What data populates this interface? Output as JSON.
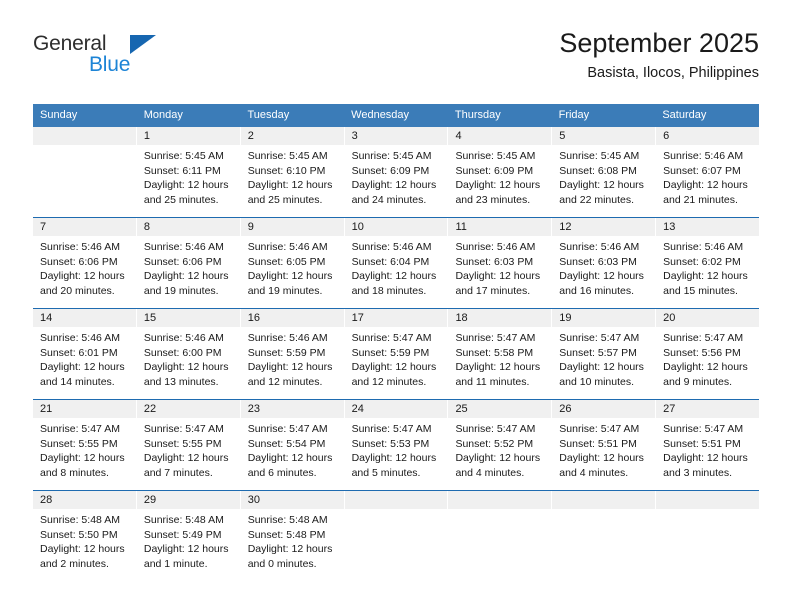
{
  "brand": {
    "name_top": "General",
    "name_bottom": "Blue",
    "accent_dark": "#1666b0",
    "accent_light": "#1d84d6"
  },
  "header": {
    "title": "September 2025",
    "subtitle": "Basista, Ilocos, Philippines"
  },
  "theme": {
    "header_row_bg": "#3b7cb8",
    "week_divider": "#1e6bb0",
    "day_band_bg": "#f0f0f0"
  },
  "weekdays": [
    "Sunday",
    "Monday",
    "Tuesday",
    "Wednesday",
    "Thursday",
    "Friday",
    "Saturday"
  ],
  "weeks": [
    {
      "days": [
        {
          "num": "",
          "sunrise": "",
          "sunset": "",
          "daylight_1": "",
          "daylight_2": "",
          "empty": true
        },
        {
          "num": "1",
          "sunrise": "Sunrise: 5:45 AM",
          "sunset": "Sunset: 6:11 PM",
          "daylight_1": "Daylight: 12 hours",
          "daylight_2": "and 25 minutes."
        },
        {
          "num": "2",
          "sunrise": "Sunrise: 5:45 AM",
          "sunset": "Sunset: 6:10 PM",
          "daylight_1": "Daylight: 12 hours",
          "daylight_2": "and 25 minutes."
        },
        {
          "num": "3",
          "sunrise": "Sunrise: 5:45 AM",
          "sunset": "Sunset: 6:09 PM",
          "daylight_1": "Daylight: 12 hours",
          "daylight_2": "and 24 minutes."
        },
        {
          "num": "4",
          "sunrise": "Sunrise: 5:45 AM",
          "sunset": "Sunset: 6:09 PM",
          "daylight_1": "Daylight: 12 hours",
          "daylight_2": "and 23 minutes."
        },
        {
          "num": "5",
          "sunrise": "Sunrise: 5:45 AM",
          "sunset": "Sunset: 6:08 PM",
          "daylight_1": "Daylight: 12 hours",
          "daylight_2": "and 22 minutes."
        },
        {
          "num": "6",
          "sunrise": "Sunrise: 5:46 AM",
          "sunset": "Sunset: 6:07 PM",
          "daylight_1": "Daylight: 12 hours",
          "daylight_2": "and 21 minutes."
        }
      ]
    },
    {
      "days": [
        {
          "num": "7",
          "sunrise": "Sunrise: 5:46 AM",
          "sunset": "Sunset: 6:06 PM",
          "daylight_1": "Daylight: 12 hours",
          "daylight_2": "and 20 minutes."
        },
        {
          "num": "8",
          "sunrise": "Sunrise: 5:46 AM",
          "sunset": "Sunset: 6:06 PM",
          "daylight_1": "Daylight: 12 hours",
          "daylight_2": "and 19 minutes."
        },
        {
          "num": "9",
          "sunrise": "Sunrise: 5:46 AM",
          "sunset": "Sunset: 6:05 PM",
          "daylight_1": "Daylight: 12 hours",
          "daylight_2": "and 19 minutes."
        },
        {
          "num": "10",
          "sunrise": "Sunrise: 5:46 AM",
          "sunset": "Sunset: 6:04 PM",
          "daylight_1": "Daylight: 12 hours",
          "daylight_2": "and 18 minutes."
        },
        {
          "num": "11",
          "sunrise": "Sunrise: 5:46 AM",
          "sunset": "Sunset: 6:03 PM",
          "daylight_1": "Daylight: 12 hours",
          "daylight_2": "and 17 minutes."
        },
        {
          "num": "12",
          "sunrise": "Sunrise: 5:46 AM",
          "sunset": "Sunset: 6:03 PM",
          "daylight_1": "Daylight: 12 hours",
          "daylight_2": "and 16 minutes."
        },
        {
          "num": "13",
          "sunrise": "Sunrise: 5:46 AM",
          "sunset": "Sunset: 6:02 PM",
          "daylight_1": "Daylight: 12 hours",
          "daylight_2": "and 15 minutes."
        }
      ]
    },
    {
      "days": [
        {
          "num": "14",
          "sunrise": "Sunrise: 5:46 AM",
          "sunset": "Sunset: 6:01 PM",
          "daylight_1": "Daylight: 12 hours",
          "daylight_2": "and 14 minutes."
        },
        {
          "num": "15",
          "sunrise": "Sunrise: 5:46 AM",
          "sunset": "Sunset: 6:00 PM",
          "daylight_1": "Daylight: 12 hours",
          "daylight_2": "and 13 minutes."
        },
        {
          "num": "16",
          "sunrise": "Sunrise: 5:46 AM",
          "sunset": "Sunset: 5:59 PM",
          "daylight_1": "Daylight: 12 hours",
          "daylight_2": "and 12 minutes."
        },
        {
          "num": "17",
          "sunrise": "Sunrise: 5:47 AM",
          "sunset": "Sunset: 5:59 PM",
          "daylight_1": "Daylight: 12 hours",
          "daylight_2": "and 12 minutes."
        },
        {
          "num": "18",
          "sunrise": "Sunrise: 5:47 AM",
          "sunset": "Sunset: 5:58 PM",
          "daylight_1": "Daylight: 12 hours",
          "daylight_2": "and 11 minutes."
        },
        {
          "num": "19",
          "sunrise": "Sunrise: 5:47 AM",
          "sunset": "Sunset: 5:57 PM",
          "daylight_1": "Daylight: 12 hours",
          "daylight_2": "and 10 minutes."
        },
        {
          "num": "20",
          "sunrise": "Sunrise: 5:47 AM",
          "sunset": "Sunset: 5:56 PM",
          "daylight_1": "Daylight: 12 hours",
          "daylight_2": "and 9 minutes."
        }
      ]
    },
    {
      "days": [
        {
          "num": "21",
          "sunrise": "Sunrise: 5:47 AM",
          "sunset": "Sunset: 5:55 PM",
          "daylight_1": "Daylight: 12 hours",
          "daylight_2": "and 8 minutes."
        },
        {
          "num": "22",
          "sunrise": "Sunrise: 5:47 AM",
          "sunset": "Sunset: 5:55 PM",
          "daylight_1": "Daylight: 12 hours",
          "daylight_2": "and 7 minutes."
        },
        {
          "num": "23",
          "sunrise": "Sunrise: 5:47 AM",
          "sunset": "Sunset: 5:54 PM",
          "daylight_1": "Daylight: 12 hours",
          "daylight_2": "and 6 minutes."
        },
        {
          "num": "24",
          "sunrise": "Sunrise: 5:47 AM",
          "sunset": "Sunset: 5:53 PM",
          "daylight_1": "Daylight: 12 hours",
          "daylight_2": "and 5 minutes."
        },
        {
          "num": "25",
          "sunrise": "Sunrise: 5:47 AM",
          "sunset": "Sunset: 5:52 PM",
          "daylight_1": "Daylight: 12 hours",
          "daylight_2": "and 4 minutes."
        },
        {
          "num": "26",
          "sunrise": "Sunrise: 5:47 AM",
          "sunset": "Sunset: 5:51 PM",
          "daylight_1": "Daylight: 12 hours",
          "daylight_2": "and 4 minutes."
        },
        {
          "num": "27",
          "sunrise": "Sunrise: 5:47 AM",
          "sunset": "Sunset: 5:51 PM",
          "daylight_1": "Daylight: 12 hours",
          "daylight_2": "and 3 minutes."
        }
      ]
    },
    {
      "days": [
        {
          "num": "28",
          "sunrise": "Sunrise: 5:48 AM",
          "sunset": "Sunset: 5:50 PM",
          "daylight_1": "Daylight: 12 hours",
          "daylight_2": "and 2 minutes."
        },
        {
          "num": "29",
          "sunrise": "Sunrise: 5:48 AM",
          "sunset": "Sunset: 5:49 PM",
          "daylight_1": "Daylight: 12 hours",
          "daylight_2": "and 1 minute."
        },
        {
          "num": "30",
          "sunrise": "Sunrise: 5:48 AM",
          "sunset": "Sunset: 5:48 PM",
          "daylight_1": "Daylight: 12 hours",
          "daylight_2": "and 0 minutes."
        },
        {
          "num": "",
          "sunrise": "",
          "sunset": "",
          "daylight_1": "",
          "daylight_2": "",
          "empty": true
        },
        {
          "num": "",
          "sunrise": "",
          "sunset": "",
          "daylight_1": "",
          "daylight_2": "",
          "empty": true
        },
        {
          "num": "",
          "sunrise": "",
          "sunset": "",
          "daylight_1": "",
          "daylight_2": "",
          "empty": true
        },
        {
          "num": "",
          "sunrise": "",
          "sunset": "",
          "daylight_1": "",
          "daylight_2": "",
          "empty": true
        }
      ]
    }
  ]
}
